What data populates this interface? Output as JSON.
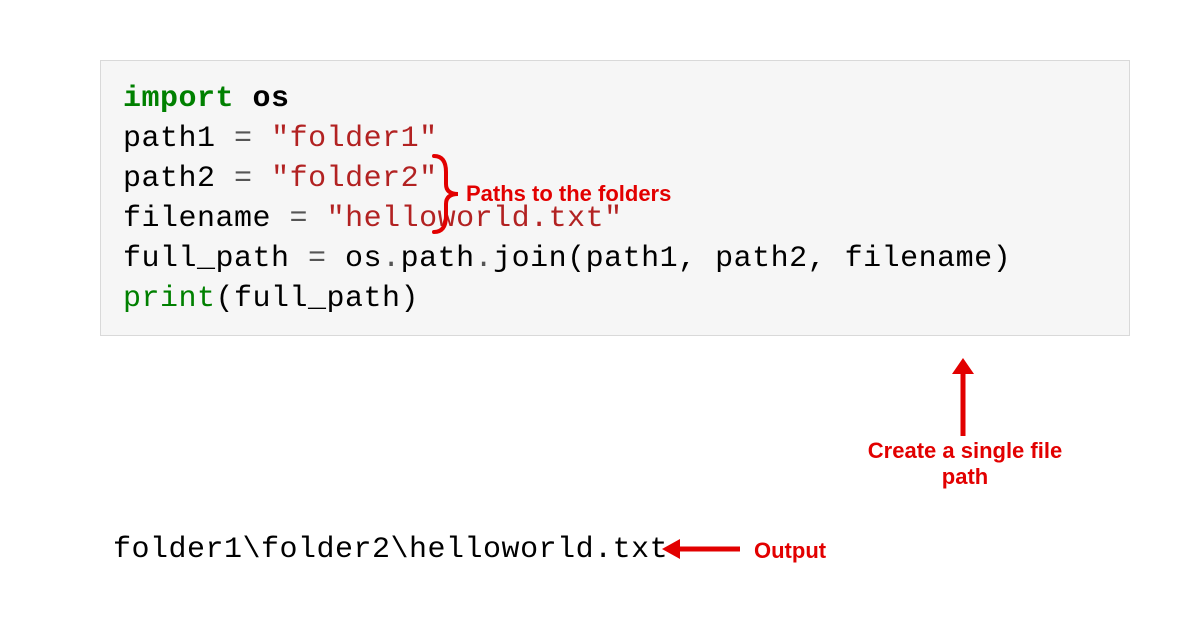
{
  "code": {
    "line1": {
      "import": "import",
      "os": " os"
    },
    "line2": "",
    "line3": {
      "var": "path1 ",
      "eq": "=",
      "sp": " ",
      "str": "\"folder1\""
    },
    "line4": {
      "var": "path2 ",
      "eq": "=",
      "sp": " ",
      "str": "\"folder2\""
    },
    "line5": {
      "var": "filename ",
      "eq": "=",
      "sp": " ",
      "str": "\"helloworld.txt\""
    },
    "line6": "",
    "line7": {
      "a": "full_path ",
      "eq": "=",
      "b": " os",
      "c": ".",
      "d": "path",
      "e": ".",
      "f": "join(path1, path2, filename)"
    },
    "line8": {
      "print": "print",
      "args": "(full_path)"
    }
  },
  "output": "folder1\\folder2\\helloworld.txt",
  "annotations": {
    "paths_label": "Paths to the folders",
    "create_label_l1": "Create a single file",
    "create_label_l2": "path",
    "output_label": "Output"
  }
}
